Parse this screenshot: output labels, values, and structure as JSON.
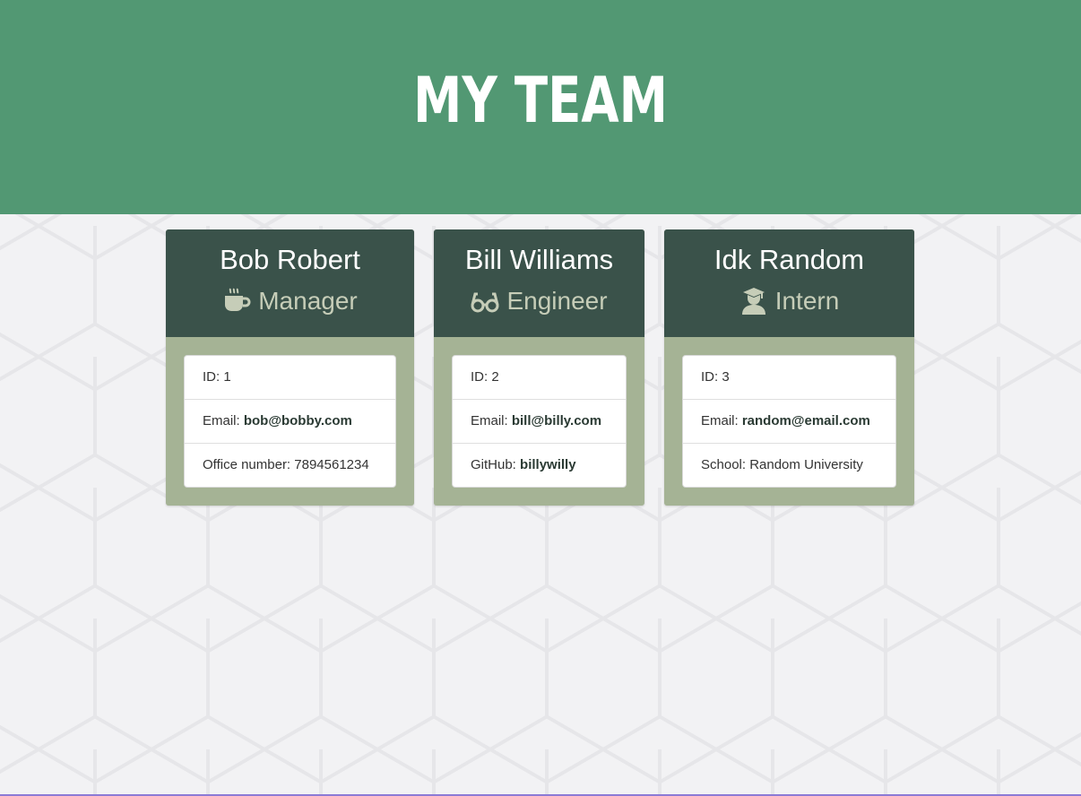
{
  "header": {
    "title": "MY TEAM"
  },
  "colors": {
    "header_bg": "#529873",
    "card_header_bg": "#3a524a",
    "card_body_bg": "#a5b395",
    "role_text": "#c6cdb8"
  },
  "team": [
    {
      "name": "Bob Robert",
      "role": "Manager",
      "icon": "coffee-mug-icon",
      "id_label": "ID: 1",
      "email_label": "Email: ",
      "email": "bob@bobby.com",
      "extra_label": "Office number: 7894561234",
      "extra_value": ""
    },
    {
      "name": "Bill Williams",
      "role": "Engineer",
      "icon": "glasses-icon",
      "id_label": "ID: 2",
      "email_label": "Email: ",
      "email": "bill@billy.com",
      "extra_label": "GitHub: ",
      "extra_value": "billywilly"
    },
    {
      "name": "Idk Random",
      "role": "Intern",
      "icon": "graduate-icon",
      "id_label": "ID: 3",
      "email_label": "Email: ",
      "email": "random@email.com",
      "extra_label": "School: Random University",
      "extra_value": ""
    }
  ]
}
